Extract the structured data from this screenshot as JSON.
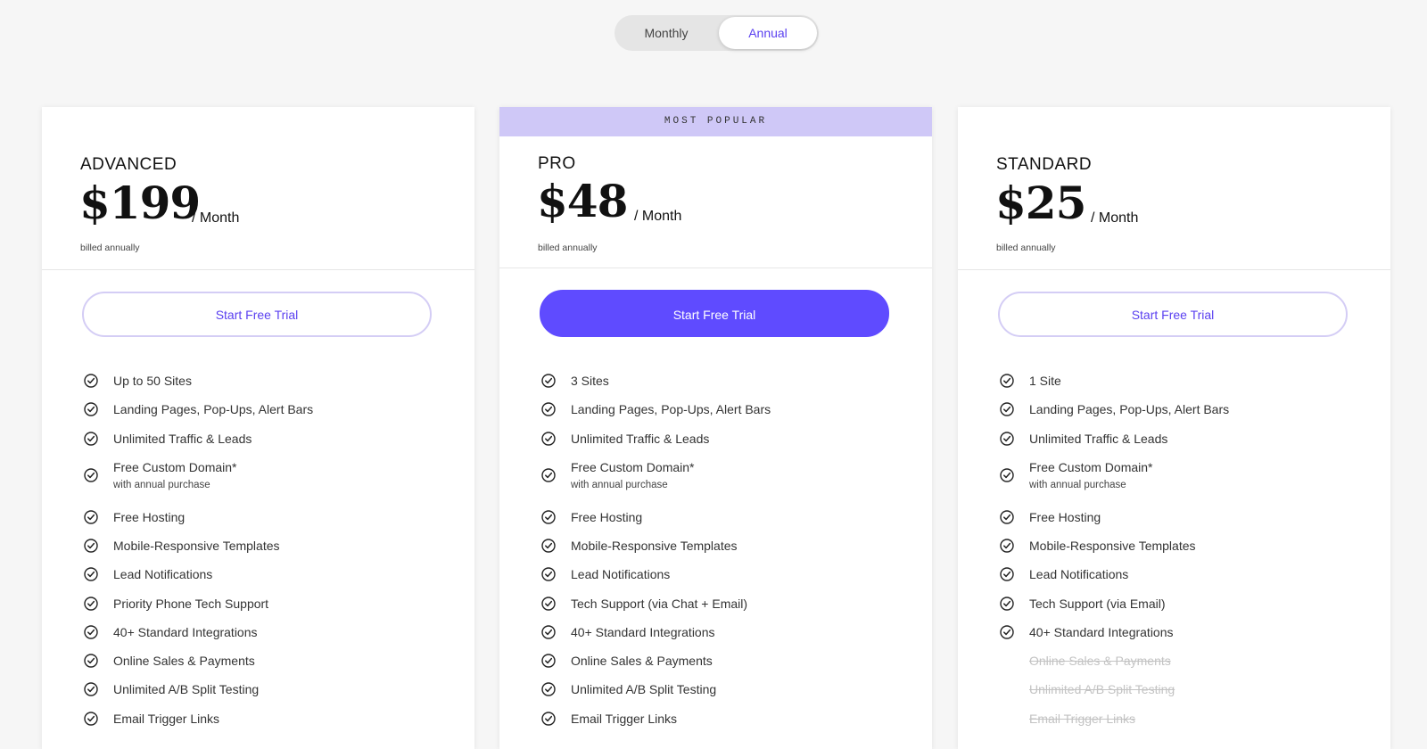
{
  "billing_toggle": {
    "monthly_label": "Monthly",
    "annual_label": "Annual",
    "selected": "Annual"
  },
  "colors": {
    "accent": "#5f4bff",
    "banner": "#cfc8f7",
    "background": "#f6f6f6"
  },
  "plans": [
    {
      "name": "ADVANCED",
      "price": "$199",
      "period": "/ Month",
      "billing_note": "billed annually",
      "cta": "Start Free Trial",
      "features": [
        {
          "label": "Up to 50 Sites",
          "included": true
        },
        {
          "label": "Landing Pages, Pop-Ups, Alert Bars",
          "included": true
        },
        {
          "label": "Unlimited Traffic & Leads",
          "included": true
        },
        {
          "label": "Free Custom Domain*",
          "sub": "with annual purchase",
          "included": true
        },
        {
          "label": "Free Hosting",
          "included": true
        },
        {
          "label": "Mobile-Responsive Templates",
          "included": true
        },
        {
          "label": "Lead Notifications",
          "included": true
        },
        {
          "label": "Priority Phone Tech Support",
          "included": true
        },
        {
          "label": "40+ Standard Integrations",
          "included": true
        },
        {
          "label": "Online Sales & Payments",
          "included": true
        },
        {
          "label": "Unlimited A/B Split Testing",
          "included": true
        },
        {
          "label": "Email Trigger Links",
          "included": true
        }
      ]
    },
    {
      "name": "PRO",
      "badge": "MOST POPULAR",
      "price": "$48",
      "period": "/ Month",
      "billing_note": "billed annually",
      "cta": "Start Free Trial",
      "features": [
        {
          "label": "3 Sites",
          "included": true
        },
        {
          "label": "Landing Pages, Pop-Ups, Alert Bars",
          "included": true
        },
        {
          "label": "Unlimited Traffic & Leads",
          "included": true
        },
        {
          "label": "Free Custom Domain*",
          "sub": "with annual purchase",
          "included": true
        },
        {
          "label": "Free Hosting",
          "included": true
        },
        {
          "label": "Mobile-Responsive Templates",
          "included": true
        },
        {
          "label": "Lead Notifications",
          "included": true
        },
        {
          "label": "Tech Support (via Chat + Email)",
          "included": true
        },
        {
          "label": "40+ Standard Integrations",
          "included": true
        },
        {
          "label": "Online Sales & Payments",
          "included": true
        },
        {
          "label": "Unlimited A/B Split Testing",
          "included": true
        },
        {
          "label": "Email Trigger Links",
          "included": true
        }
      ]
    },
    {
      "name": "STANDARD",
      "price": "$25",
      "period": "/ Month",
      "billing_note": "billed annually",
      "cta": "Start Free Trial",
      "features": [
        {
          "label": "1 Site",
          "included": true
        },
        {
          "label": "Landing Pages, Pop-Ups, Alert Bars",
          "included": true
        },
        {
          "label": "Unlimited Traffic & Leads",
          "included": true
        },
        {
          "label": "Free Custom Domain*",
          "sub": "with annual purchase",
          "included": true
        },
        {
          "label": "Free Hosting",
          "included": true
        },
        {
          "label": "Mobile-Responsive Templates",
          "included": true
        },
        {
          "label": "Lead Notifications",
          "included": true
        },
        {
          "label": "Tech Support (via Email)",
          "included": true
        },
        {
          "label": "40+ Standard Integrations",
          "included": true
        },
        {
          "label": "Online Sales & Payments",
          "included": false
        },
        {
          "label": "Unlimited A/B Split Testing",
          "included": false
        },
        {
          "label": "Email Trigger Links",
          "included": false
        }
      ]
    }
  ]
}
